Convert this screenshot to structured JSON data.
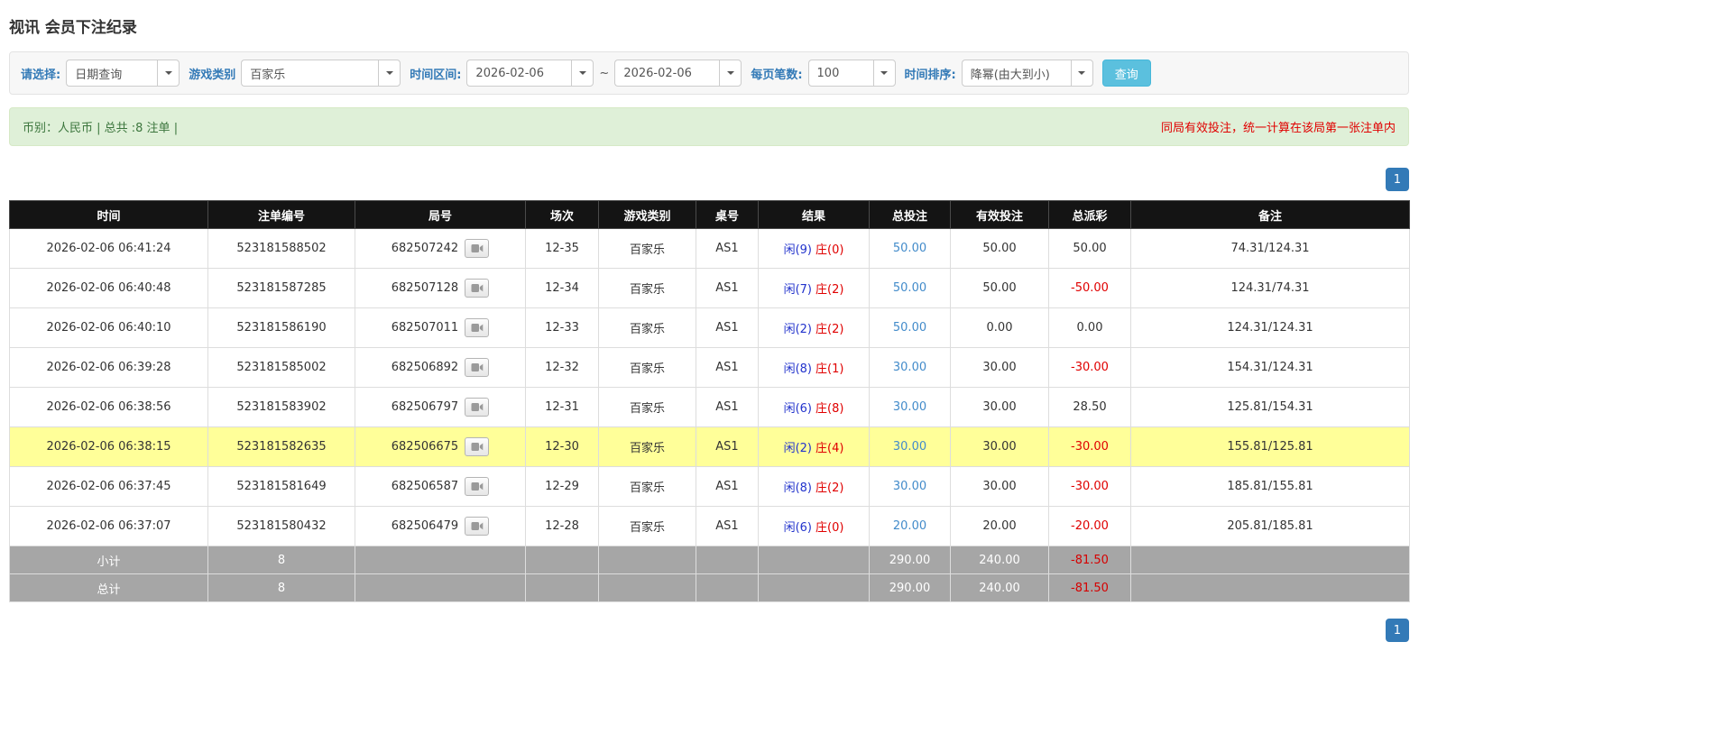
{
  "page": {
    "title": "视讯 会员下注纪录"
  },
  "filters": {
    "select_label": "请选择:",
    "select_value": "日期查询",
    "game_label": "游戏类别",
    "game_value": "百家乐",
    "range_label": "时间区间:",
    "range_start": "2026-02-06",
    "range_separator": "~",
    "range_end": "2026-02-06",
    "page_size_label": "每页笔数:",
    "page_size_value": "100",
    "sort_label": "时间排序:",
    "sort_value": "降幂(由大到小)",
    "search_button": "查询"
  },
  "summary_bar": {
    "left_text": "币别：人民币 | 总共 :8 注单 |",
    "right_text": "同局有效投注，统一计算在该局第一张注单内"
  },
  "pagination": {
    "page": "1"
  },
  "colors": {
    "accent_blue": "#337ab7",
    "link_blue": "#428bca",
    "player_blue": "#2233cc",
    "banker_red": "#e00000",
    "negative_red": "#e00000",
    "highlight_yellow": "#ffff99",
    "header_black": "#141414",
    "footer_gray": "#a6a6a6",
    "success_bg": "#dff0d8",
    "success_text": "#3c763d",
    "search_button_bg": "#5bc0de"
  },
  "table": {
    "headers": [
      "时间",
      "注单编号",
      "局号",
      "场次",
      "游戏类别",
      "桌号",
      "结果",
      "总投注",
      "有效投注",
      "总派彩",
      "备注"
    ],
    "rows": [
      {
        "time": "2026-02-06 06:41:24",
        "order_id": "523181588502",
        "round_id": "682507242",
        "session": "12-35",
        "game": "百家乐",
        "table_no": "AS1",
        "result_player": "闲(9)",
        "result_banker": "庄(0)",
        "total_bet": "50.00",
        "valid_bet": "50.00",
        "payout": "50.00",
        "payout_negative": false,
        "remark": "74.31/124.31",
        "highlight": false
      },
      {
        "time": "2026-02-06 06:40:48",
        "order_id": "523181587285",
        "round_id": "682507128",
        "session": "12-34",
        "game": "百家乐",
        "table_no": "AS1",
        "result_player": "闲(7)",
        "result_banker": "庄(2)",
        "total_bet": "50.00",
        "valid_bet": "50.00",
        "payout": "-50.00",
        "payout_negative": true,
        "remark": "124.31/74.31",
        "highlight": false
      },
      {
        "time": "2026-02-06 06:40:10",
        "order_id": "523181586190",
        "round_id": "682507011",
        "session": "12-33",
        "game": "百家乐",
        "table_no": "AS1",
        "result_player": "闲(2)",
        "result_banker": "庄(2)",
        "total_bet": "50.00",
        "valid_bet": "0.00",
        "payout": "0.00",
        "payout_negative": false,
        "remark": "124.31/124.31",
        "highlight": false
      },
      {
        "time": "2026-02-06 06:39:28",
        "order_id": "523181585002",
        "round_id": "682506892",
        "session": "12-32",
        "game": "百家乐",
        "table_no": "AS1",
        "result_player": "闲(8)",
        "result_banker": "庄(1)",
        "total_bet": "30.00",
        "valid_bet": "30.00",
        "payout": "-30.00",
        "payout_negative": true,
        "remark": "154.31/124.31",
        "highlight": false
      },
      {
        "time": "2026-02-06 06:38:56",
        "order_id": "523181583902",
        "round_id": "682506797",
        "session": "12-31",
        "game": "百家乐",
        "table_no": "AS1",
        "result_player": "闲(6)",
        "result_banker": "庄(8)",
        "total_bet": "30.00",
        "valid_bet": "30.00",
        "payout": "28.50",
        "payout_negative": false,
        "remark": "125.81/154.31",
        "highlight": false
      },
      {
        "time": "2026-02-06 06:38:15",
        "order_id": "523181582635",
        "round_id": "682506675",
        "session": "12-30",
        "game": "百家乐",
        "table_no": "AS1",
        "result_player": "闲(2)",
        "result_banker": "庄(4)",
        "total_bet": "30.00",
        "valid_bet": "30.00",
        "payout": "-30.00",
        "payout_negative": true,
        "remark": "155.81/125.81",
        "highlight": true
      },
      {
        "time": "2026-02-06 06:37:45",
        "order_id": "523181581649",
        "round_id": "682506587",
        "session": "12-29",
        "game": "百家乐",
        "table_no": "AS1",
        "result_player": "闲(8)",
        "result_banker": "庄(2)",
        "total_bet": "30.00",
        "valid_bet": "30.00",
        "payout": "-30.00",
        "payout_negative": true,
        "remark": "185.81/155.81",
        "highlight": false
      },
      {
        "time": "2026-02-06 06:37:07",
        "order_id": "523181580432",
        "round_id": "682506479",
        "session": "12-28",
        "game": "百家乐",
        "table_no": "AS1",
        "result_player": "闲(6)",
        "result_banker": "庄(0)",
        "total_bet": "20.00",
        "valid_bet": "20.00",
        "payout": "-20.00",
        "payout_negative": true,
        "remark": "205.81/185.81",
        "highlight": false
      }
    ],
    "subtotal": {
      "label": "小计",
      "count": "8",
      "total_bet": "290.00",
      "valid_bet": "240.00",
      "payout": "-81.50"
    },
    "total": {
      "label": "总计",
      "count": "8",
      "total_bet": "290.00",
      "valid_bet": "240.00",
      "payout": "-81.50"
    }
  }
}
